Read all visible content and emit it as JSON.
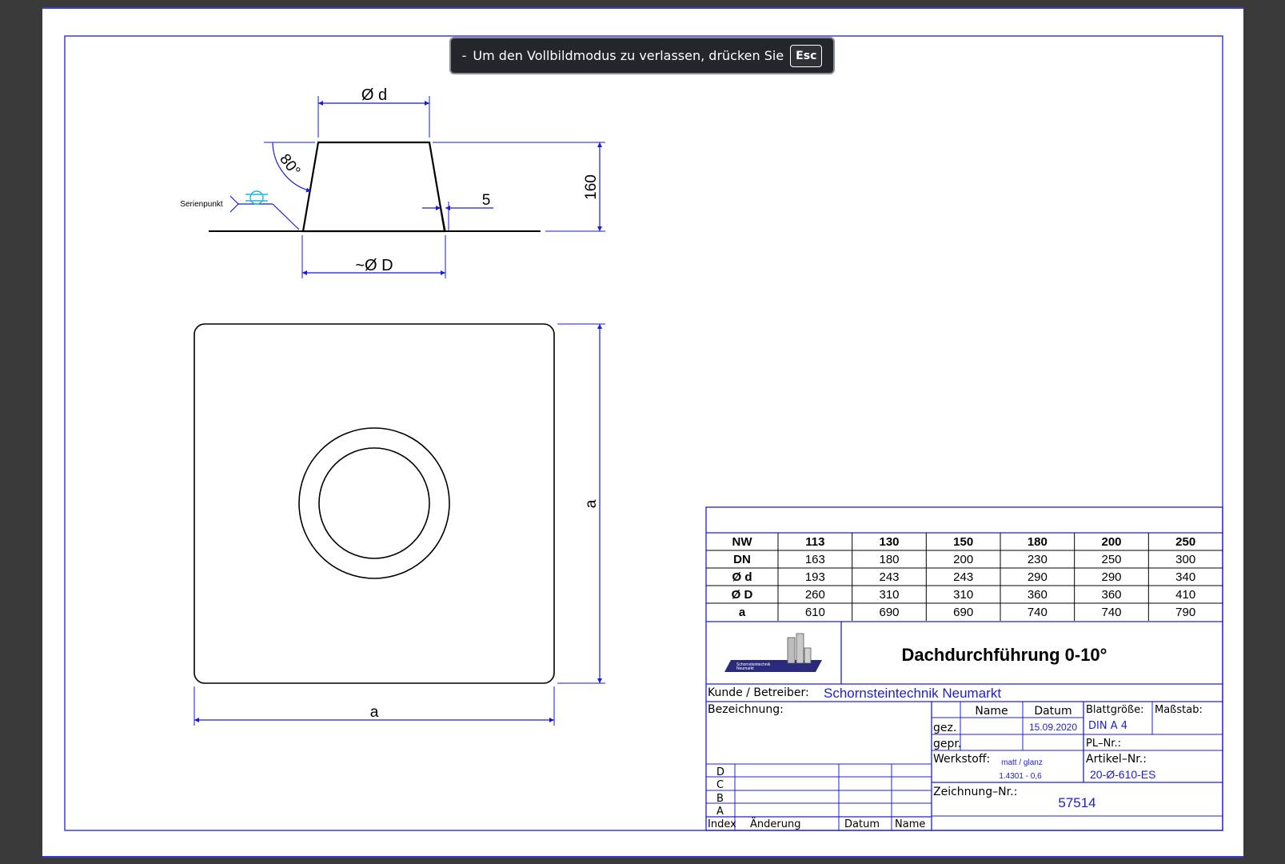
{
  "overlay": {
    "message": "Um den Vollbildmodus zu verlassen, drücken Sie",
    "key": "Esc"
  },
  "colors": {
    "frame": "#2020c8",
    "dimension": "#1a1ad8",
    "outline": "#000000",
    "symbol_cyan": "#1fb4e0",
    "background": "#3a3a3a",
    "overlay_bg": "#23262b"
  },
  "side_view": {
    "dim_d": "Ø d",
    "dim_D": "~Ø D",
    "angle": "80°",
    "height": "160",
    "wall": "5",
    "series_label": "Serienpunkt"
  },
  "top_view": {
    "dim_a_horizontal": "a",
    "dim_a_vertical": "a"
  },
  "table": {
    "rows": [
      [
        "NW",
        "113",
        "130",
        "150",
        "180",
        "200",
        "250"
      ],
      [
        "DN",
        "163",
        "180",
        "200",
        "230",
        "250",
        "300"
      ],
      [
        "Ø d",
        "193",
        "243",
        "243",
        "290",
        "290",
        "340"
      ],
      [
        "Ø D",
        "260",
        "310",
        "310",
        "360",
        "360",
        "410"
      ],
      [
        "a",
        "610",
        "690",
        "690",
        "740",
        "740",
        "790"
      ]
    ]
  },
  "title_block": {
    "logo_text_1": "Schornsteintechnik",
    "logo_text_2": "Neumarkt",
    "title": "Dachdurchführung 0-10°",
    "customer_label": "Kunde  /  Betreiber:",
    "customer_value": "Schornsteintechnik Neumarkt",
    "designation_label": "Bezeichnung:",
    "name_header": "Name",
    "date_header": "Datum",
    "drawn_label": "gez.",
    "drawn_date": "15.09.2020",
    "checked_label": "gepr.",
    "sheet_size_label": "Blattgröße:",
    "sheet_size_value": "DIN  A  4",
    "scale_label": "Maßstab:",
    "pl_label": "PL–Nr.:",
    "material_label": "Werkstoff:",
    "material_line1": "matt / glanz",
    "material_line2": "1.4301 - 0,6",
    "article_label": "Artikel–Nr.:",
    "article_value": "20-Ø-610-ES",
    "drawing_no_label": "Zeichnung–Nr.:",
    "drawing_no_value": "57514",
    "revisions": [
      "D",
      "C",
      "B",
      "A"
    ],
    "rev_index": "Index",
    "rev_change": "Änderung",
    "rev_date": "Datum",
    "rev_name": "Name"
  }
}
